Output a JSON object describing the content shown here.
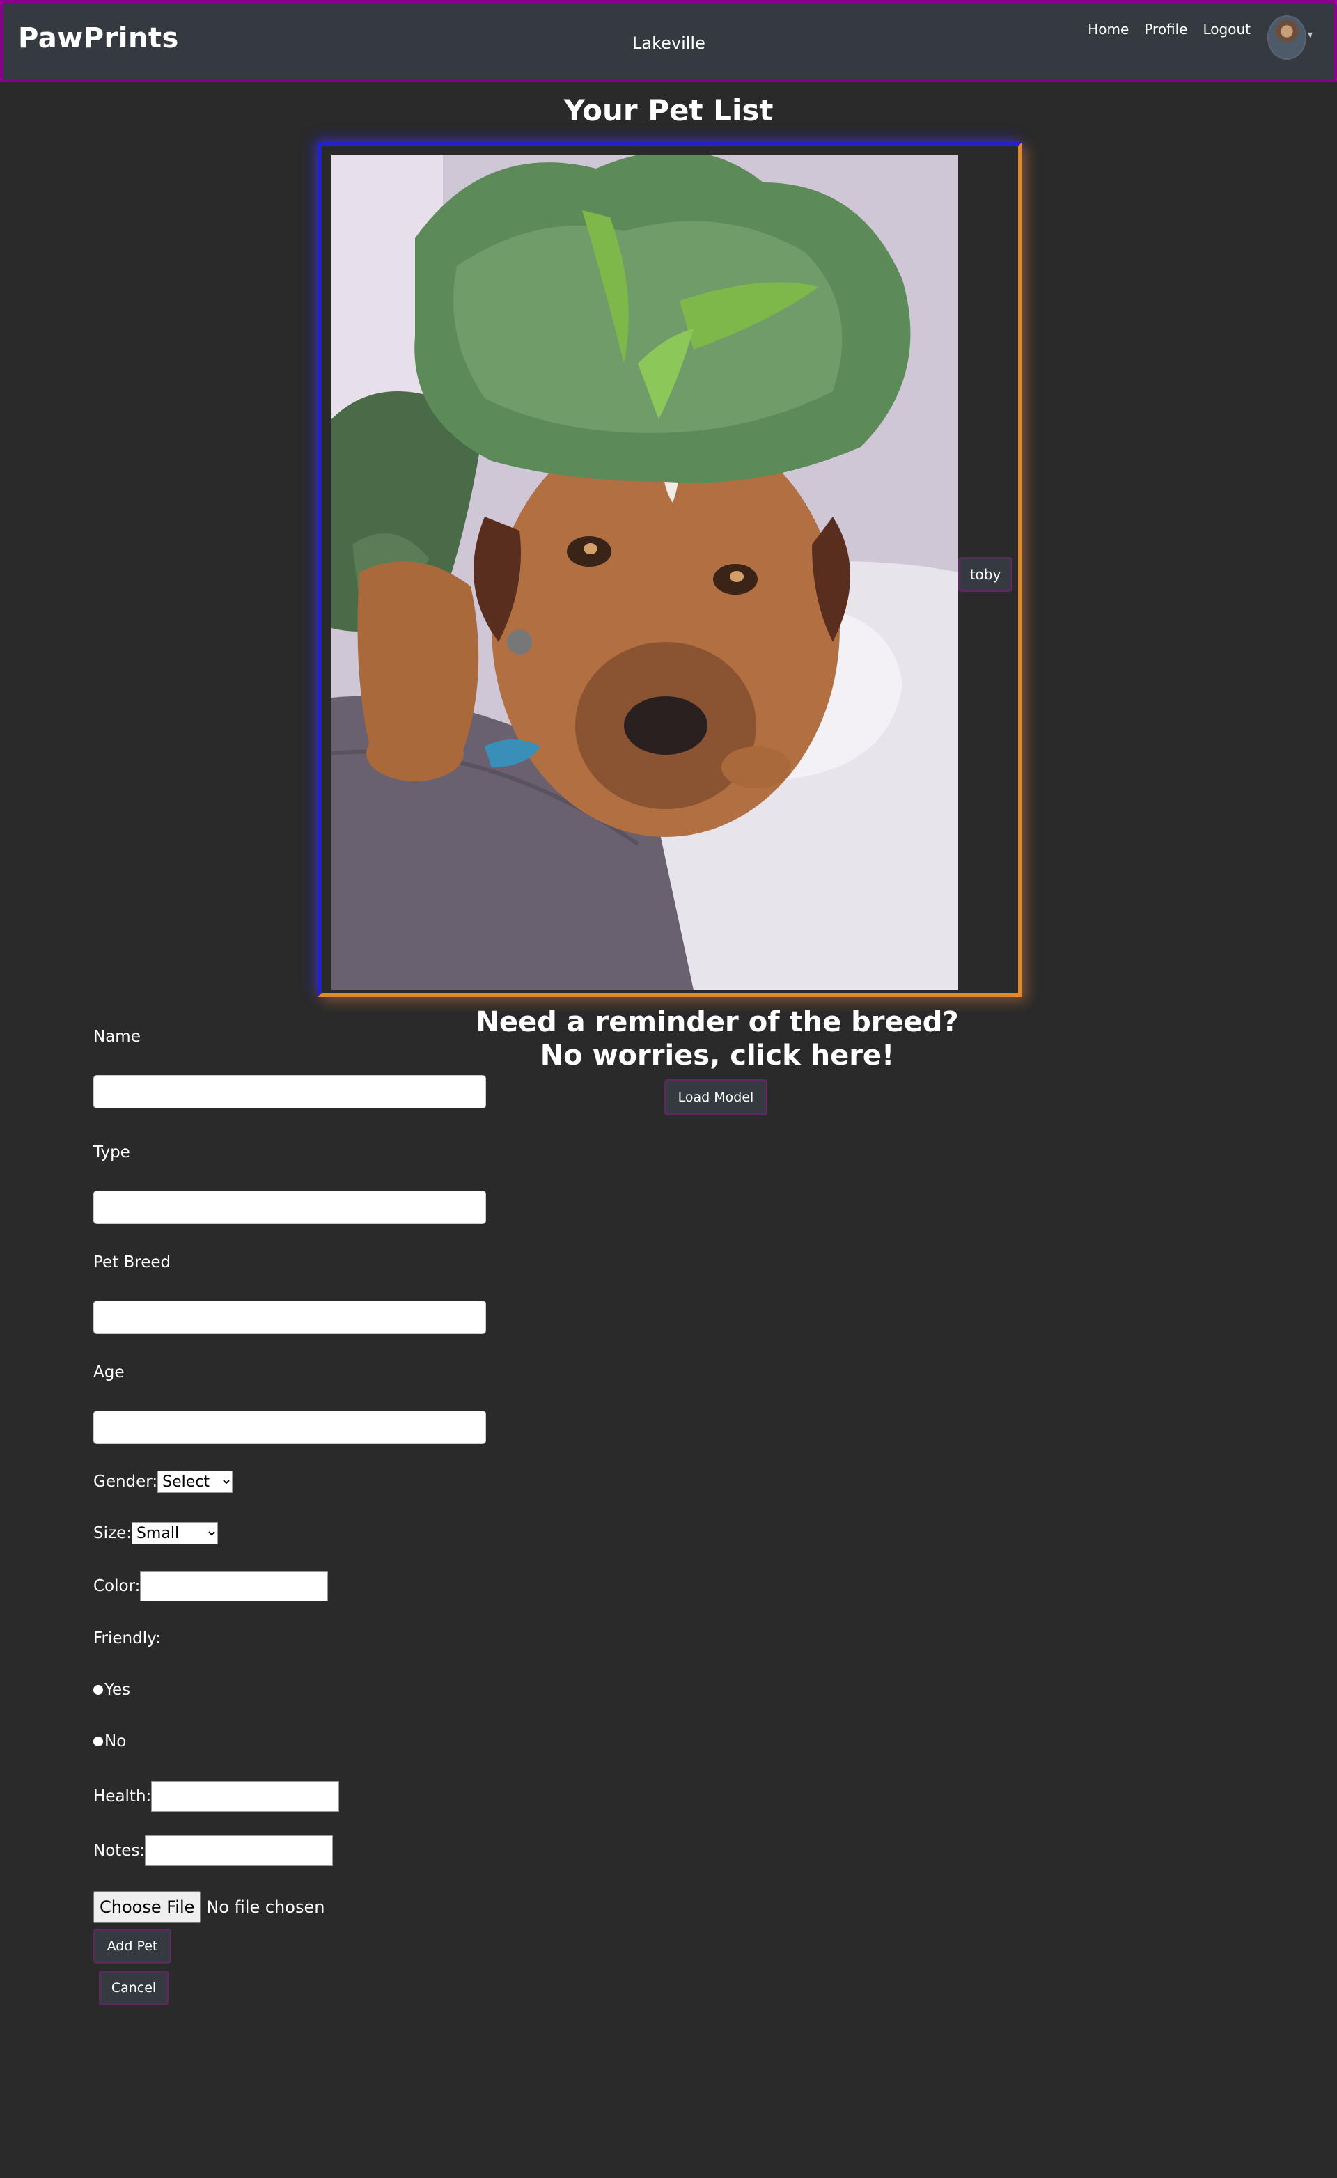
{
  "navbar": {
    "brand": "PawPrints",
    "location": "Lakeville",
    "links": [
      "Home",
      "Profile",
      "Logout"
    ],
    "avatar_icon": "user-avatar",
    "caret_icon": "caret-down-icon"
  },
  "page": {
    "title": "Your Pet List"
  },
  "pet_card": {
    "name_tag": "toby",
    "photo_subject": "dog-in-dinosaur-costume"
  },
  "breed_helper": {
    "heading_line1": "Need a reminder of the breed?",
    "heading_line2": "No worries, click here!",
    "button_label": "Load Model"
  },
  "form": {
    "name_label": "Name",
    "type_label": "Type",
    "breed_label": "Pet Breed",
    "age_label": "Age",
    "gender_label": "Gender:",
    "gender_value": "Select",
    "size_label": "Size:",
    "size_value": "Small",
    "color_label": "Color:",
    "friendly_label": "Friendly:",
    "friendly_yes": "Yes",
    "friendly_no": "No",
    "health_label": "Health:",
    "notes_label": "Notes:",
    "file_button": "Choose File",
    "file_status": "No file chosen",
    "add_button": "Add Pet",
    "cancel_button": "Cancel"
  },
  "colors": {
    "background": "#2a2a2a",
    "navbar_bg": "#343a40",
    "navbar_border": "#8b008b",
    "card_border_blue": "#2222cc",
    "card_border_orange": "#e08a2a",
    "button_border": "#5a2a5a"
  }
}
